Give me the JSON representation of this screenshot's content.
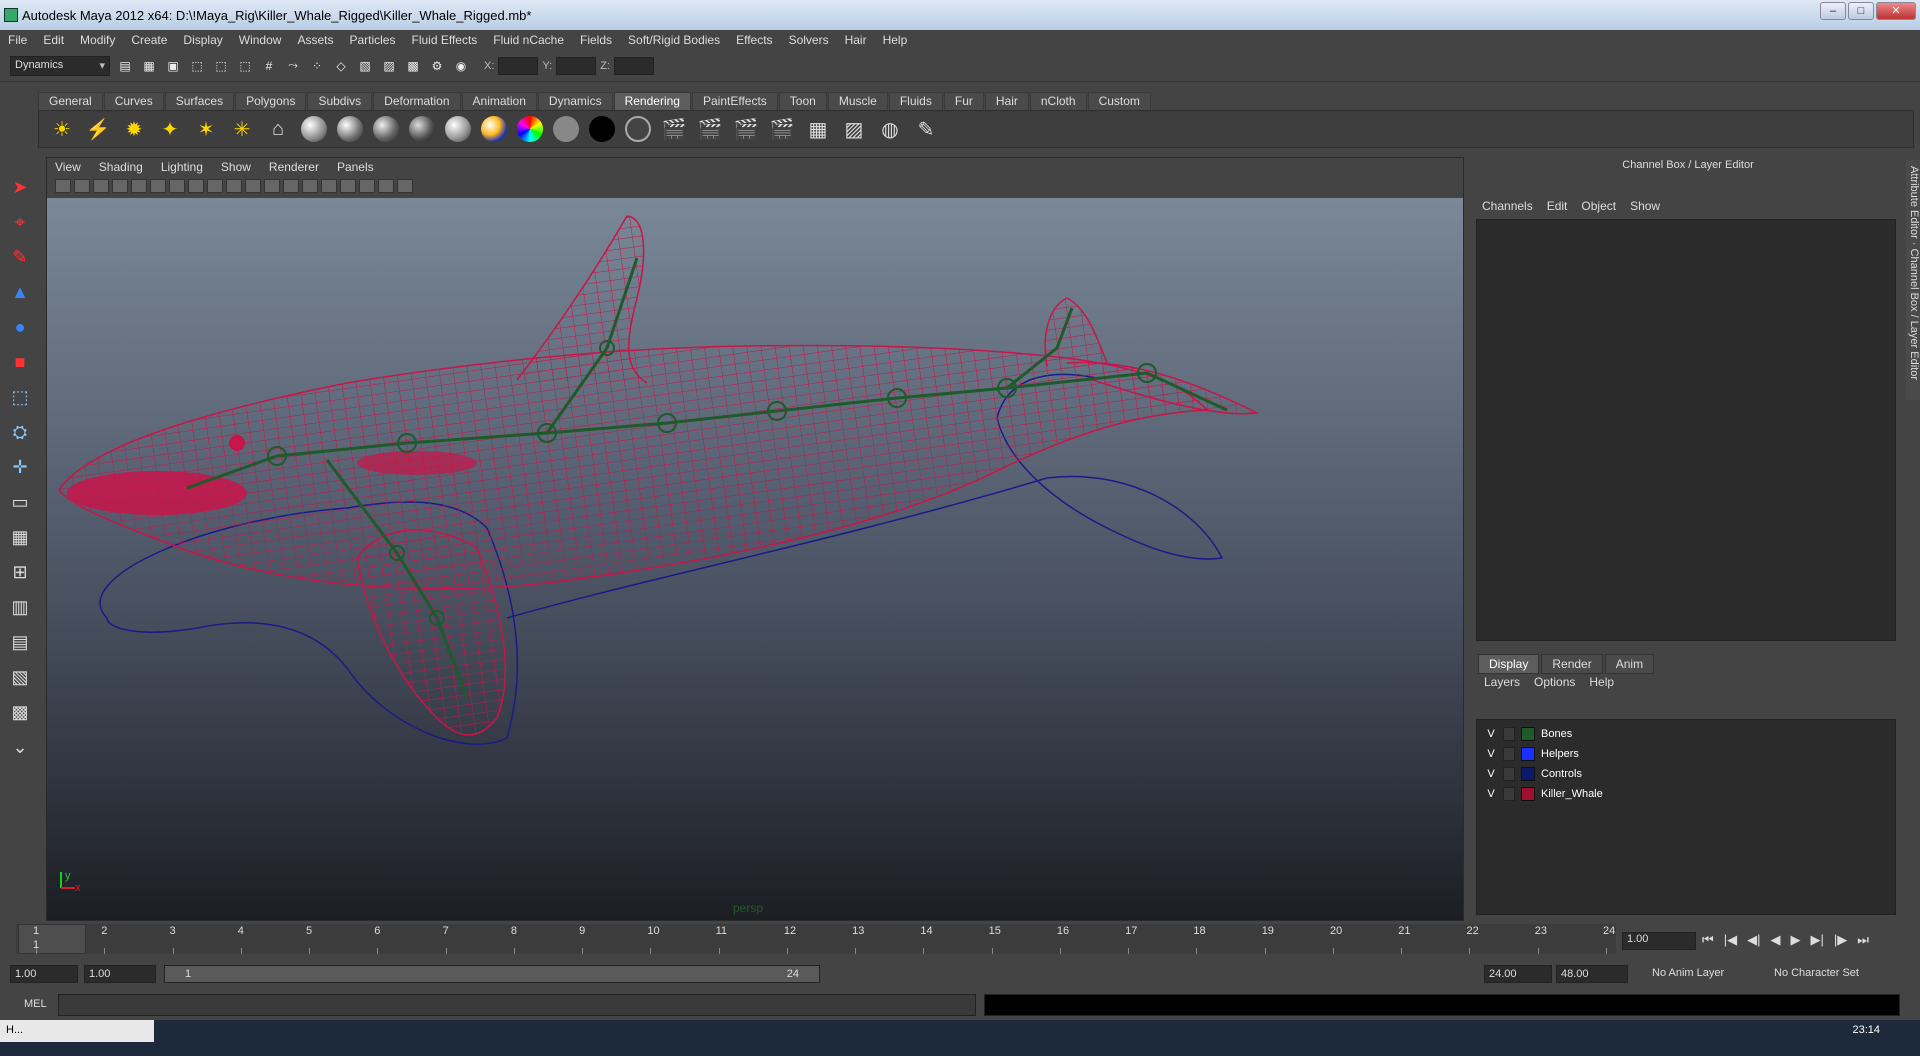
{
  "window": {
    "title": "Autodesk Maya 2012 x64: D:\\!Maya_Rig\\Killer_Whale_Rigged\\Killer_Whale_Rigged.mb*",
    "min": "–",
    "max": "□",
    "close": "✕"
  },
  "menu": [
    "File",
    "Edit",
    "Modify",
    "Create",
    "Display",
    "Window",
    "Assets",
    "Particles",
    "Fluid Effects",
    "Fluid nCache",
    "Fields",
    "Soft/Rigid Bodies",
    "Effects",
    "Solvers",
    "Hair",
    "Help"
  ],
  "statusline": {
    "mode": "Dynamics",
    "x_label": "X:",
    "y_label": "Y:",
    "z_label": "Z:"
  },
  "shelf_tabs": [
    "General",
    "Curves",
    "Surfaces",
    "Polygons",
    "Subdivs",
    "Deformation",
    "Animation",
    "Dynamics",
    "Rendering",
    "PaintEffects",
    "Toon",
    "Muscle",
    "Fluids",
    "Fur",
    "Hair",
    "nCloth",
    "Custom"
  ],
  "viewport": {
    "menu": [
      "View",
      "Shading",
      "Lighting",
      "Show",
      "Renderer",
      "Panels"
    ],
    "camera_label": "persp",
    "axis_y": "y",
    "axis_x": "x",
    "colors": {
      "mesh": "#c8154a",
      "bones": "#1e5a2a",
      "controls": "#1a1a8a"
    }
  },
  "channel_box": {
    "title": "Channel Box / Layer Editor",
    "menu": [
      "Channels",
      "Edit",
      "Object",
      "Show"
    ],
    "side_tabs": "Attribute Editor · Channel Box / Layer Editor"
  },
  "layer_editor": {
    "tabs": [
      "Display",
      "Render",
      "Anim"
    ],
    "menu": [
      "Layers",
      "Options",
      "Help"
    ],
    "layers": [
      {
        "vis": "V",
        "name": "Bones",
        "color": "#1f5a2a"
      },
      {
        "vis": "V",
        "name": "Helpers",
        "color": "#1a30ff"
      },
      {
        "vis": "V",
        "name": "Controls",
        "color": "#0c1a6a"
      },
      {
        "vis": "V",
        "name": "Killer_Whale",
        "color": "#a01030"
      }
    ]
  },
  "timeslider": {
    "frames": [
      "1",
      "2",
      "3",
      "4",
      "5",
      "6",
      "7",
      "8",
      "9",
      "10",
      "11",
      "12",
      "13",
      "14",
      "15",
      "16",
      "17",
      "18",
      "19",
      "20",
      "21",
      "22",
      "23",
      "24"
    ],
    "current": "1",
    "current_field": "1.00"
  },
  "transport": [
    "⏮",
    "|◀",
    "◀|",
    "◀",
    "▶",
    "▶|",
    "|▶",
    "⏭"
  ],
  "range": {
    "start": "1.00",
    "anim_start": "1.00",
    "slider_start": "1",
    "slider_end": "24",
    "end": "24.00",
    "anim_end": "48.00",
    "anim_layer": "No Anim Layer",
    "char_set": "No Character Set"
  },
  "mel": {
    "label": "MEL"
  },
  "taskbar": {
    "item": "H...",
    "clock": "23:14"
  }
}
